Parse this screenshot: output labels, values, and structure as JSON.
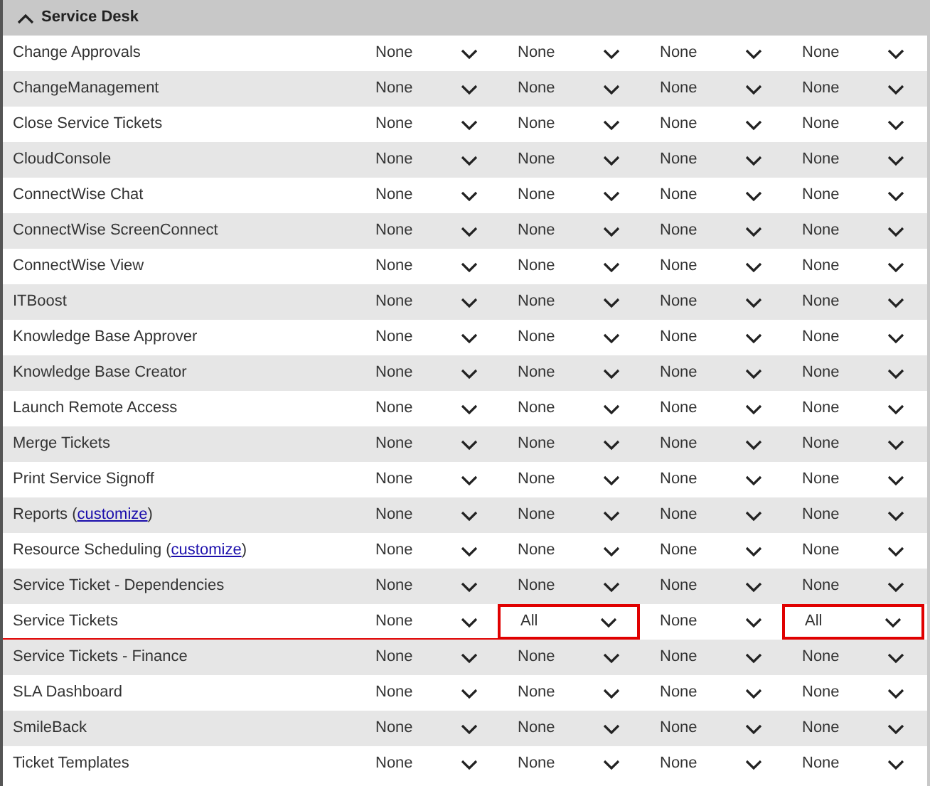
{
  "section": {
    "title": "Service Desk",
    "expanded": true
  },
  "rows": [
    {
      "label": "Change Approvals",
      "underlined": false,
      "cells": [
        {
          "value": "None",
          "highlighted": false
        },
        {
          "value": "None",
          "highlighted": false
        },
        {
          "value": "None",
          "highlighted": false
        },
        {
          "value": "None",
          "highlighted": false
        }
      ]
    },
    {
      "label": "ChangeManagement",
      "underlined": false,
      "cells": [
        {
          "value": "None",
          "highlighted": false
        },
        {
          "value": "None",
          "highlighted": false
        },
        {
          "value": "None",
          "highlighted": false
        },
        {
          "value": "None",
          "highlighted": false
        }
      ]
    },
    {
      "label": "Close Service Tickets",
      "underlined": false,
      "cells": [
        {
          "value": "None",
          "highlighted": false
        },
        {
          "value": "None",
          "highlighted": false
        },
        {
          "value": "None",
          "highlighted": false
        },
        {
          "value": "None",
          "highlighted": false
        }
      ]
    },
    {
      "label": "CloudConsole",
      "underlined": false,
      "cells": [
        {
          "value": "None",
          "highlighted": false
        },
        {
          "value": "None",
          "highlighted": false
        },
        {
          "value": "None",
          "highlighted": false
        },
        {
          "value": "None",
          "highlighted": false
        }
      ]
    },
    {
      "label": "ConnectWise Chat",
      "underlined": false,
      "cells": [
        {
          "value": "None",
          "highlighted": false
        },
        {
          "value": "None",
          "highlighted": false
        },
        {
          "value": "None",
          "highlighted": false
        },
        {
          "value": "None",
          "highlighted": false
        }
      ]
    },
    {
      "label": "ConnectWise ScreenConnect",
      "underlined": false,
      "cells": [
        {
          "value": "None",
          "highlighted": false
        },
        {
          "value": "None",
          "highlighted": false
        },
        {
          "value": "None",
          "highlighted": false
        },
        {
          "value": "None",
          "highlighted": false
        }
      ]
    },
    {
      "label": "ConnectWise View",
      "underlined": false,
      "cells": [
        {
          "value": "None",
          "highlighted": false
        },
        {
          "value": "None",
          "highlighted": false
        },
        {
          "value": "None",
          "highlighted": false
        },
        {
          "value": "None",
          "highlighted": false
        }
      ]
    },
    {
      "label": "ITBoost",
      "underlined": false,
      "cells": [
        {
          "value": "None",
          "highlighted": false
        },
        {
          "value": "None",
          "highlighted": false
        },
        {
          "value": "None",
          "highlighted": false
        },
        {
          "value": "None",
          "highlighted": false
        }
      ]
    },
    {
      "label": "Knowledge Base Approver",
      "underlined": false,
      "cells": [
        {
          "value": "None",
          "highlighted": false
        },
        {
          "value": "None",
          "highlighted": false
        },
        {
          "value": "None",
          "highlighted": false
        },
        {
          "value": "None",
          "highlighted": false
        }
      ]
    },
    {
      "label": "Knowledge Base Creator",
      "underlined": false,
      "cells": [
        {
          "value": "None",
          "highlighted": false
        },
        {
          "value": "None",
          "highlighted": false
        },
        {
          "value": "None",
          "highlighted": false
        },
        {
          "value": "None",
          "highlighted": false
        }
      ]
    },
    {
      "label": "Launch Remote Access",
      "underlined": false,
      "cells": [
        {
          "value": "None",
          "highlighted": false
        },
        {
          "value": "None",
          "highlighted": false
        },
        {
          "value": "None",
          "highlighted": false
        },
        {
          "value": "None",
          "highlighted": false
        }
      ]
    },
    {
      "label": "Merge Tickets",
      "underlined": false,
      "cells": [
        {
          "value": "None",
          "highlighted": false
        },
        {
          "value": "None",
          "highlighted": false
        },
        {
          "value": "None",
          "highlighted": false
        },
        {
          "value": "None",
          "highlighted": false
        }
      ]
    },
    {
      "label": "Print Service Signoff",
      "underlined": false,
      "cells": [
        {
          "value": "None",
          "highlighted": false
        },
        {
          "value": "None",
          "highlighted": false
        },
        {
          "value": "None",
          "highlighted": false
        },
        {
          "value": "None",
          "highlighted": false
        }
      ]
    },
    {
      "label": "Reports (",
      "link": "customize",
      "label_end": ")",
      "underlined": false,
      "cells": [
        {
          "value": "None",
          "highlighted": false
        },
        {
          "value": "None",
          "highlighted": false
        },
        {
          "value": "None",
          "highlighted": false
        },
        {
          "value": "None",
          "highlighted": false
        }
      ]
    },
    {
      "label": "Resource Scheduling (",
      "link": "customize",
      "label_end": ")",
      "underlined": false,
      "cells": [
        {
          "value": "None",
          "highlighted": false
        },
        {
          "value": "None",
          "highlighted": false
        },
        {
          "value": "None",
          "highlighted": false
        },
        {
          "value": "None",
          "highlighted": false
        }
      ]
    },
    {
      "label": "Service Ticket - Dependencies",
      "underlined": false,
      "cells": [
        {
          "value": "None",
          "highlighted": false
        },
        {
          "value": "None",
          "highlighted": false
        },
        {
          "value": "None",
          "highlighted": false
        },
        {
          "value": "None",
          "highlighted": false
        }
      ]
    },
    {
      "label": "Service Tickets",
      "underlined": true,
      "cells": [
        {
          "value": "None",
          "highlighted": false
        },
        {
          "value": "All",
          "highlighted": true
        },
        {
          "value": "None",
          "highlighted": false
        },
        {
          "value": "All",
          "highlighted": true
        }
      ]
    },
    {
      "label": "Service Tickets - Finance",
      "underlined": false,
      "cells": [
        {
          "value": "None",
          "highlighted": false
        },
        {
          "value": "None",
          "highlighted": false
        },
        {
          "value": "None",
          "highlighted": false
        },
        {
          "value": "None",
          "highlighted": false
        }
      ]
    },
    {
      "label": "SLA Dashboard",
      "underlined": false,
      "cells": [
        {
          "value": "None",
          "highlighted": false
        },
        {
          "value": "None",
          "highlighted": false
        },
        {
          "value": "None",
          "highlighted": false
        },
        {
          "value": "None",
          "highlighted": false
        }
      ]
    },
    {
      "label": "SmileBack",
      "underlined": false,
      "cells": [
        {
          "value": "None",
          "highlighted": false
        },
        {
          "value": "None",
          "highlighted": false
        },
        {
          "value": "None",
          "highlighted": false
        },
        {
          "value": "None",
          "highlighted": false
        }
      ]
    },
    {
      "label": "Ticket Templates",
      "underlined": false,
      "cells": [
        {
          "value": "None",
          "highlighted": false
        },
        {
          "value": "None",
          "highlighted": false
        },
        {
          "value": "None",
          "highlighted": false
        },
        {
          "value": "None",
          "highlighted": false
        }
      ]
    }
  ]
}
